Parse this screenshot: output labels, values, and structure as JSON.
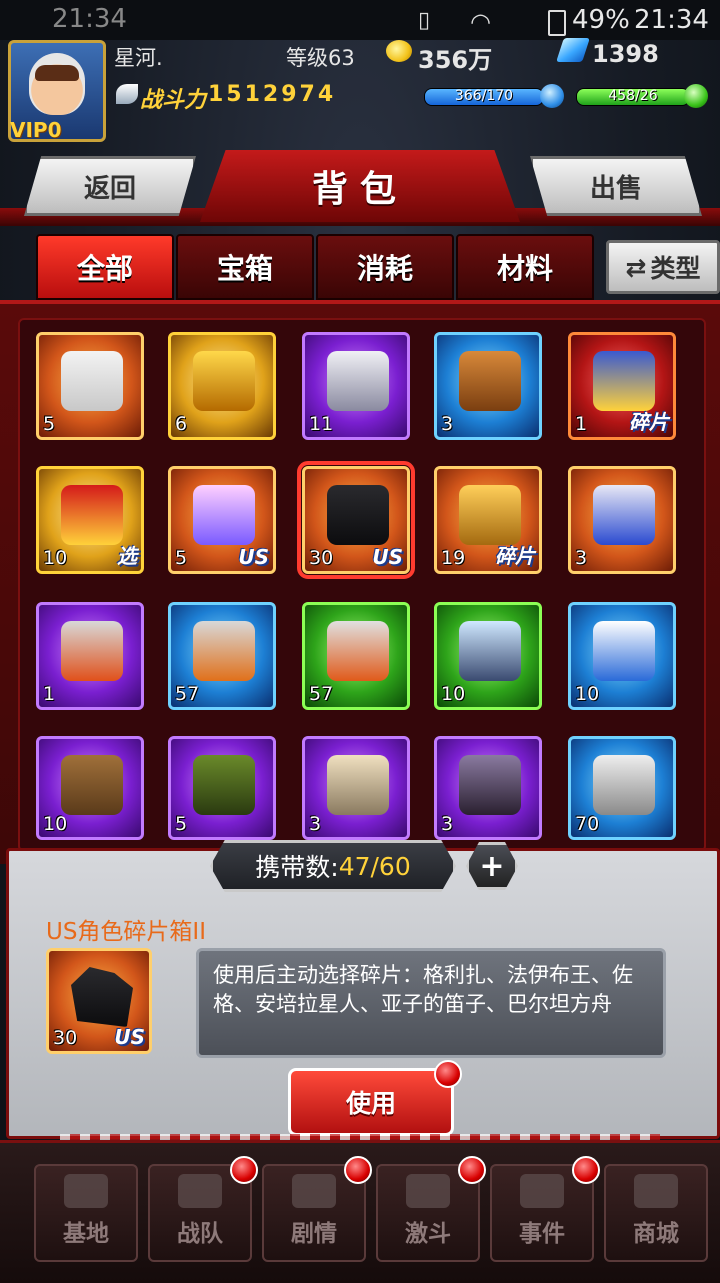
{
  "status_bar": {
    "left_time": "21:34",
    "battery": "49%",
    "time": "21:34"
  },
  "player": {
    "name": "星河.",
    "level": "等级63",
    "vip": "VIP0",
    "power_label": "战斗力",
    "power": "1512974"
  },
  "resources": {
    "gold": "356万",
    "gems": "1398",
    "stamina": "366/170",
    "energy": "458/26"
  },
  "buttons": {
    "back": "返回",
    "sell": "出售",
    "type": "类型",
    "use": "使用"
  },
  "title": "背包",
  "tabs": [
    "全部",
    "宝箱",
    "消耗",
    "材料"
  ],
  "items": [
    {
      "count": "5",
      "tag": "",
      "color": "orange"
    },
    {
      "count": "6",
      "tag": "",
      "color": "yellow"
    },
    {
      "count": "11",
      "tag": "",
      "color": "purple"
    },
    {
      "count": "3",
      "tag": "",
      "color": "blue"
    },
    {
      "count": "1",
      "tag": "碎片",
      "color": "red"
    },
    {
      "count": "10",
      "tag": "选",
      "color": "yellow"
    },
    {
      "count": "5",
      "tag": "US",
      "color": "orange"
    },
    {
      "count": "30",
      "tag": "US",
      "color": "orange"
    },
    {
      "count": "19",
      "tag": "碎片",
      "color": "orange"
    },
    {
      "count": "3",
      "tag": "",
      "color": "orange"
    },
    {
      "count": "1",
      "tag": "",
      "color": "purple"
    },
    {
      "count": "57",
      "tag": "",
      "color": "blue"
    },
    {
      "count": "57",
      "tag": "",
      "color": "green"
    },
    {
      "count": "10",
      "tag": "",
      "color": "green"
    },
    {
      "count": "10",
      "tag": "",
      "color": "blue"
    },
    {
      "count": "10",
      "tag": "",
      "color": "purple"
    },
    {
      "count": "5",
      "tag": "",
      "color": "purple"
    },
    {
      "count": "3",
      "tag": "",
      "color": "purple"
    },
    {
      "count": "3",
      "tag": "",
      "color": "purple"
    },
    {
      "count": "70",
      "tag": "",
      "color": "blue"
    }
  ],
  "capacity": {
    "label": "携带数:",
    "value": "47/60"
  },
  "selected": {
    "name": "US角色碎片箱II",
    "count": "30",
    "tag": "US",
    "description": "使用后主动选择碎片：格利扎、法伊布王、佐格、安培拉星人、亚子的笛子、巴尔坦方舟"
  },
  "nav": [
    "基地",
    "战队",
    "剧情",
    "激斗",
    "事件",
    "商城"
  ]
}
